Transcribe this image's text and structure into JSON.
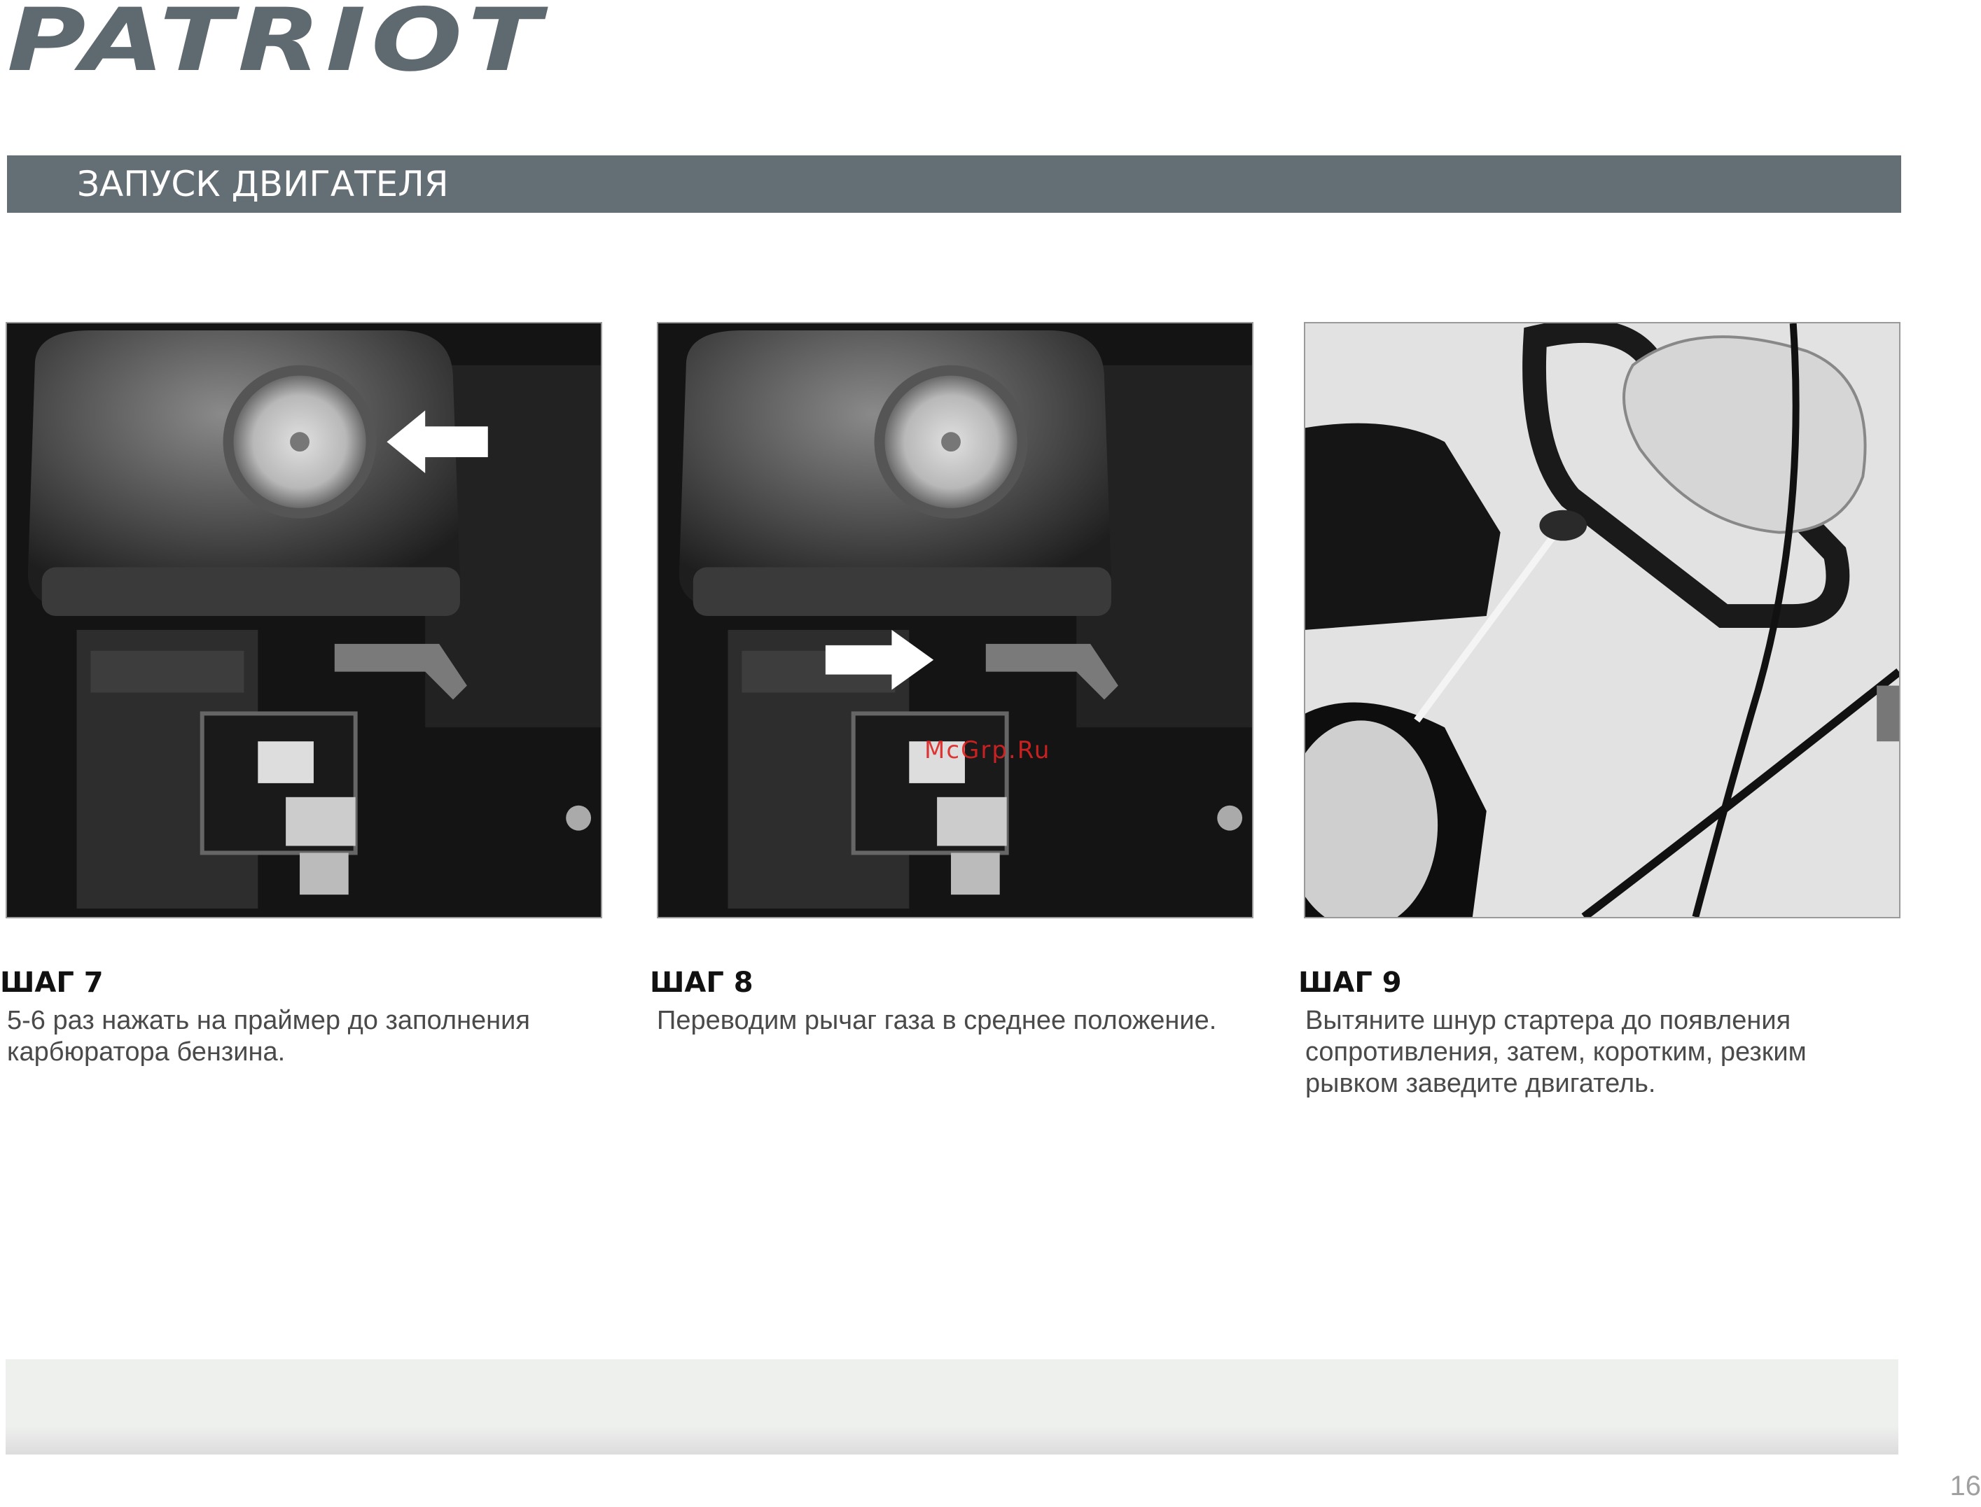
{
  "brand": {
    "logo_text": "PATRIOT"
  },
  "section": {
    "title": "ЗАПУСК ДВИГАТЕЛЯ"
  },
  "steps": [
    {
      "title": "ШАГ 7",
      "text": "5-6 раз нажать на праймер до заполнения\nкарбюратора бензина."
    },
    {
      "title": "ШАГ 8",
      "text": "Переводим рычаг газа в среднее положение."
    },
    {
      "title": "ШАГ 9",
      "text": "Вытяните шнур стартера до появления\nсопротивления, затем, коротким, резким\nрывком заведите  двигатель."
    }
  ],
  "watermark": "McGrp.Ru",
  "page_number": "16",
  "colors": {
    "section_bar": "#646e75",
    "logo": "#5f6a70"
  }
}
